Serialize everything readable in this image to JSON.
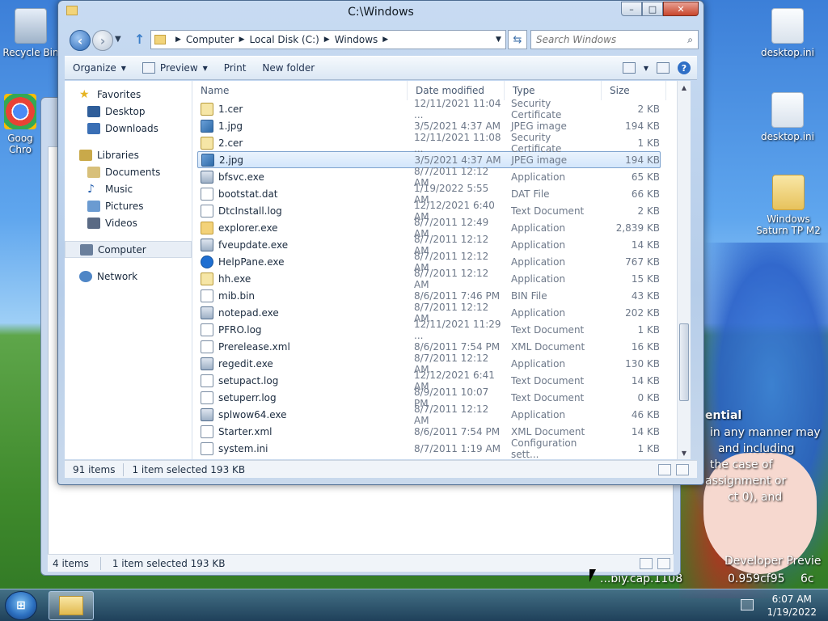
{
  "desktop": {
    "icons": [
      {
        "label": "Recycle Bin"
      },
      {
        "label": "Goog Chro"
      },
      {
        "label": "desktop.ini"
      },
      {
        "label": "desktop.ini"
      },
      {
        "label": "Windows Saturn TP M2"
      }
    ],
    "wallpaper_text": [
      "ential",
      "in any manner may",
      "and including",
      "the case of",
      "assignment or",
      "ct 0), and",
      "Developer Previe",
      "...bly.cap.1108",
      "0.959cf95",
      "6c"
    ]
  },
  "background_window": {
    "status": {
      "items": "4 items",
      "selected": "1 item selected  193 KB"
    }
  },
  "window": {
    "title": "C:\\Windows",
    "caption": {
      "minimize": "–",
      "maximize": "□",
      "close": "✕"
    },
    "address": {
      "crumbs": [
        "Computer",
        "Local Disk (C:)",
        "Windows"
      ]
    },
    "search": {
      "placeholder": "Search Windows"
    },
    "toolbar": {
      "organize": "Organize",
      "preview": "Preview",
      "print": "Print",
      "new_folder": "New folder"
    },
    "nav": {
      "favorites": "Favorites",
      "favorites_items": [
        "Desktop",
        "Downloads"
      ],
      "libraries": "Libraries",
      "libraries_items": [
        "Documents",
        "Music",
        "Pictures",
        "Videos"
      ],
      "computer": "Computer",
      "network": "Network"
    },
    "columns": {
      "name": "Name",
      "date": "Date modified",
      "type": "Type",
      "size": "Size"
    },
    "files": [
      {
        "name": "1.cer",
        "date": "12/11/2021 11:04 ...",
        "type": "Security Certificate",
        "size": "2 KB",
        "icon": "cert"
      },
      {
        "name": "1.jpg",
        "date": "3/5/2021 4:37 AM",
        "type": "JPEG image",
        "size": "194 KB",
        "icon": "img"
      },
      {
        "name": "2.cer",
        "date": "12/11/2021 11:08 ...",
        "type": "Security Certificate",
        "size": "1 KB",
        "icon": "cert"
      },
      {
        "name": "2.jpg",
        "date": "3/5/2021 4:37 AM",
        "type": "JPEG image",
        "size": "194 KB",
        "icon": "img"
      },
      {
        "name": "bfsvc.exe",
        "date": "8/7/2011 12:12 AM",
        "type": "Application",
        "size": "65 KB",
        "icon": "app"
      },
      {
        "name": "bootstat.dat",
        "date": "1/19/2022 5:55 AM",
        "type": "DAT File",
        "size": "66 KB",
        "icon": "txt"
      },
      {
        "name": "DtcInstall.log",
        "date": "12/12/2021 6:40 AM",
        "type": "Text Document",
        "size": "2 KB",
        "icon": "txt"
      },
      {
        "name": "explorer.exe",
        "date": "8/7/2011 12:49 AM",
        "type": "Application",
        "size": "2,839 KB",
        "icon": "fold"
      },
      {
        "name": "fveupdate.exe",
        "date": "8/7/2011 12:12 AM",
        "type": "Application",
        "size": "14 KB",
        "icon": "app"
      },
      {
        "name": "HelpPane.exe",
        "date": "8/7/2011 12:12 AM",
        "type": "Application",
        "size": "767 KB",
        "icon": "help"
      },
      {
        "name": "hh.exe",
        "date": "8/7/2011 12:12 AM",
        "type": "Application",
        "size": "15 KB",
        "icon": "cert"
      },
      {
        "name": "mib.bin",
        "date": "8/6/2011 7:46 PM",
        "type": "BIN File",
        "size": "43 KB",
        "icon": "txt"
      },
      {
        "name": "notepad.exe",
        "date": "8/7/2011 12:12 AM",
        "type": "Application",
        "size": "202 KB",
        "icon": "app"
      },
      {
        "name": "PFRO.log",
        "date": "12/11/2021 11:29 ...",
        "type": "Text Document",
        "size": "1 KB",
        "icon": "txt"
      },
      {
        "name": "Prerelease.xml",
        "date": "8/6/2011 7:54 PM",
        "type": "XML Document",
        "size": "16 KB",
        "icon": "txt"
      },
      {
        "name": "regedit.exe",
        "date": "8/7/2011 12:12 AM",
        "type": "Application",
        "size": "130 KB",
        "icon": "app"
      },
      {
        "name": "setupact.log",
        "date": "12/12/2021 6:41 AM",
        "type": "Text Document",
        "size": "14 KB",
        "icon": "txt"
      },
      {
        "name": "setuperr.log",
        "date": "8/9/2011 10:07 PM",
        "type": "Text Document",
        "size": "0 KB",
        "icon": "txt"
      },
      {
        "name": "splwow64.exe",
        "date": "8/7/2011 12:12 AM",
        "type": "Application",
        "size": "46 KB",
        "icon": "app"
      },
      {
        "name": "Starter.xml",
        "date": "8/6/2011 7:54 PM",
        "type": "XML Document",
        "size": "14 KB",
        "icon": "txt"
      },
      {
        "name": "system.ini",
        "date": "8/7/2011 1:19 AM",
        "type": "Configuration sett...",
        "size": "1 KB",
        "icon": "txt"
      }
    ],
    "selected_index": 3,
    "status": {
      "items": "91 items",
      "selected": "1 item selected  193 KB"
    }
  },
  "taskbar": {
    "start": "⊞",
    "time": "6:07 AM",
    "date": "1/19/2022"
  }
}
